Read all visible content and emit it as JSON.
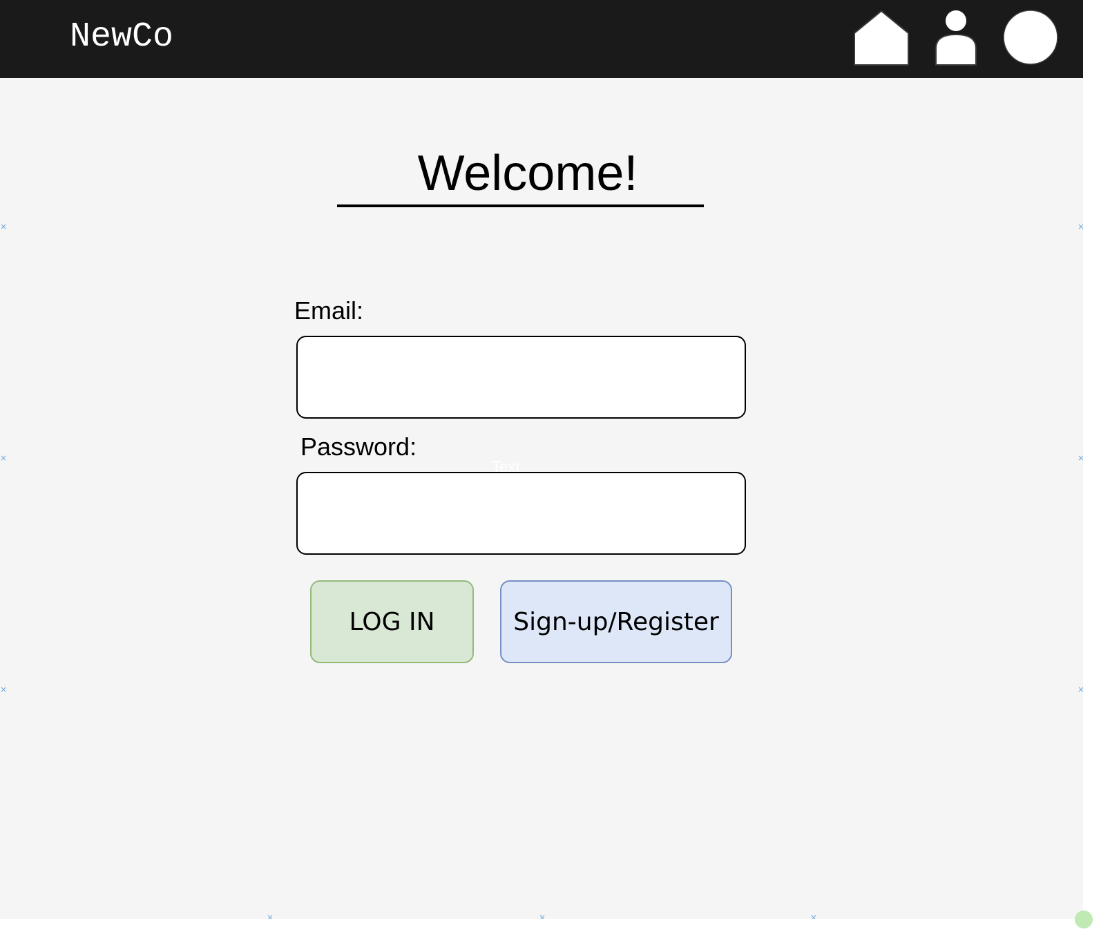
{
  "header": {
    "brand": "NewCo",
    "icons": [
      "home-icon",
      "user-icon",
      "avatar"
    ],
    "background_color": "#1a1a1a",
    "icon_color": "#ffffff"
  },
  "main": {
    "title": "Welcome!",
    "email": {
      "label": "Email:",
      "value": "",
      "placeholder": ""
    },
    "password": {
      "label": "Password:",
      "value": "",
      "placeholder": ""
    },
    "overlay_text": "Text",
    "buttons": {
      "login": {
        "label": "LOG IN",
        "fill": "#d9e8d4",
        "stroke": "#93b97b"
      },
      "signup": {
        "label": "Sign-up/Register",
        "fill": "#dde7f8",
        "stroke": "#7690c4"
      }
    }
  },
  "colors": {
    "page_background": "#f5f5f5",
    "field_background": "#ffffff",
    "text": "#000000"
  }
}
